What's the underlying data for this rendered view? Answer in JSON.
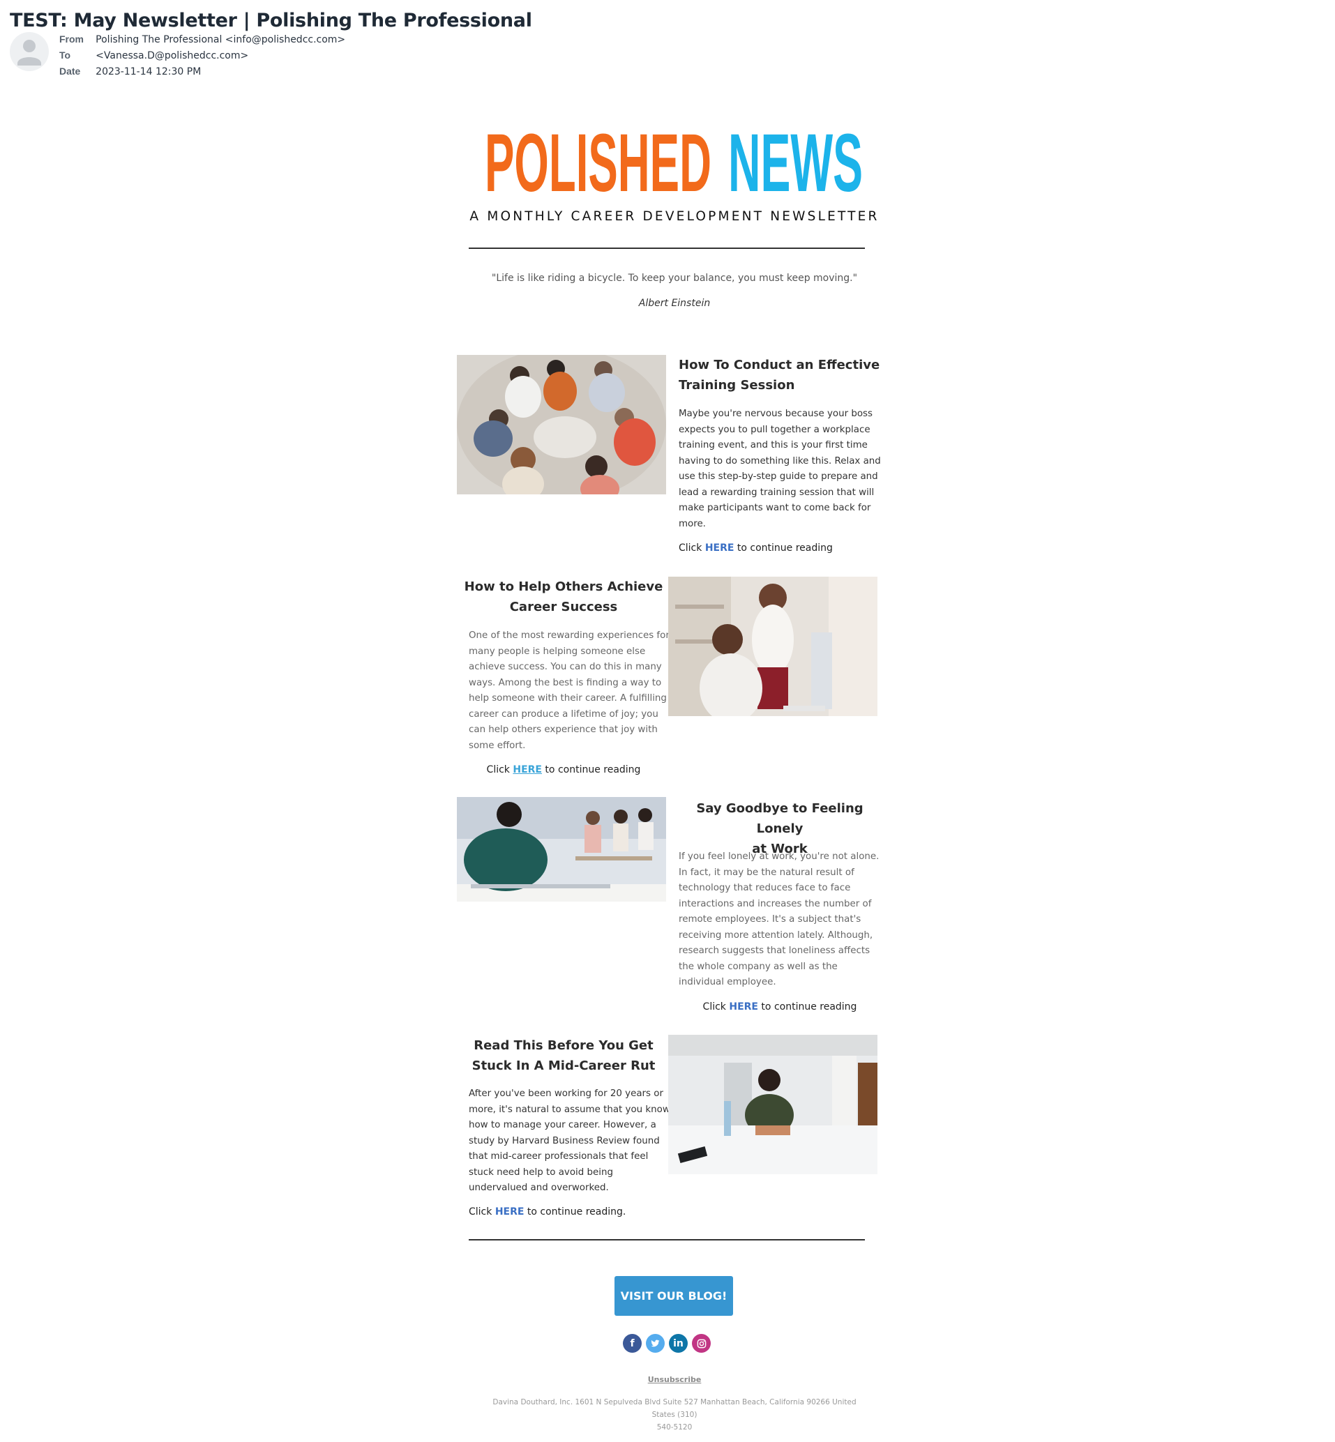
{
  "email": {
    "subject": "TEST: May Newsletter | Polishing The Professional",
    "from_label": "From",
    "from_value": "Polishing The Professional <info@polishedcc.com>",
    "to_label": "To",
    "to_value": "<Vanessa.D@polishedcc.com>",
    "date_label": "Date",
    "date_value": "2023-11-14 12:30 PM"
  },
  "newsletter": {
    "logo_word_1": "POLISHED",
    "logo_word_2": "NEWS",
    "logo_color_1": "#f26a1b",
    "logo_color_2": "#1cb3ea",
    "tagline": "A MONTHLY CAREER DEVELOPMENT NEWSLETTER",
    "quote": "\"Life is like riding a bicycle. To keep your balance, you must keep moving.\"",
    "quote_author": "Albert Einstein"
  },
  "articles": [
    {
      "title_line1": "How To Conduct an Effective",
      "title_line2": "Training Session",
      "body": [
        "Maybe you're nervous because your boss",
        "expects you to pull together a workplace",
        "training event, and this is your first time",
        "having to do something like this. Relax and",
        "use this step-by-step guide to prepare and",
        "lead a rewarding training session that will",
        "make participants want to come back for",
        "more."
      ],
      "cta_prefix": "Click ",
      "cta_link": "HERE",
      "cta_suffix": " to continue reading"
    },
    {
      "title_line1": "How to Help Others Achieve",
      "title_line2": "Career Success",
      "body": [
        "One of the most rewarding experiences for",
        "many people is helping someone else",
        "achieve success. You can do this in many",
        "ways. Among the best is finding a way to",
        "help someone with their career. A fulfilling",
        "career can produce a lifetime of joy; you",
        "can help others experience that joy with",
        "some effort."
      ],
      "cta_prefix": "Click ",
      "cta_link": "HERE",
      "cta_suffix": " to continue reading"
    },
    {
      "title_line1": "Say Goodbye to Feeling Lonely",
      "title_line2": "at Work",
      "body": [
        "If you feel lonely at work, you're not alone.",
        "In fact, it may be the natural result of",
        "technology that reduces face to face",
        "interactions and increases the number of",
        "remote employees. It's a subject that's",
        "receiving more attention lately. Although,",
        "research suggests that loneliness affects",
        "the whole company as well as the",
        "individual employee."
      ],
      "cta_prefix": "Click ",
      "cta_link": "HERE",
      "cta_suffix": " to continue reading"
    },
    {
      "title_line1": "Read This Before You Get",
      "title_line2": "Stuck In A Mid-Career Rut",
      "body": [
        "After you've been working for 20 years or",
        "more, it's natural to assume that you know",
        "how to manage your career. However, a",
        "study by Harvard Business Review found",
        "that mid-career professionals that feel",
        "stuck need help to avoid being",
        "undervalued and overworked."
      ],
      "cta_prefix": "Click ",
      "cta_link": "HERE",
      "cta_suffix": " to continue reading."
    }
  ],
  "footer": {
    "blog_button": "VISIT OUR BLOG!",
    "social": [
      {
        "icon": "facebook-icon",
        "glyph": "f",
        "color": "#3b5998"
      },
      {
        "icon": "twitter-icon",
        "glyph": "t",
        "color": "#55acee"
      },
      {
        "icon": "linkedin-icon",
        "glyph": "in",
        "color": "#0e76a8"
      },
      {
        "icon": "instagram-icon",
        "glyph": "ig",
        "color": "#c13584"
      }
    ],
    "unsubscribe": "Unsubscribe",
    "address_line1": "Davina Douthard, Inc. 1601 N Sepulveda Blvd Suite 527 Manhattan Beach, California 90266 United States (310)",
    "address_line2": "540-5120"
  }
}
